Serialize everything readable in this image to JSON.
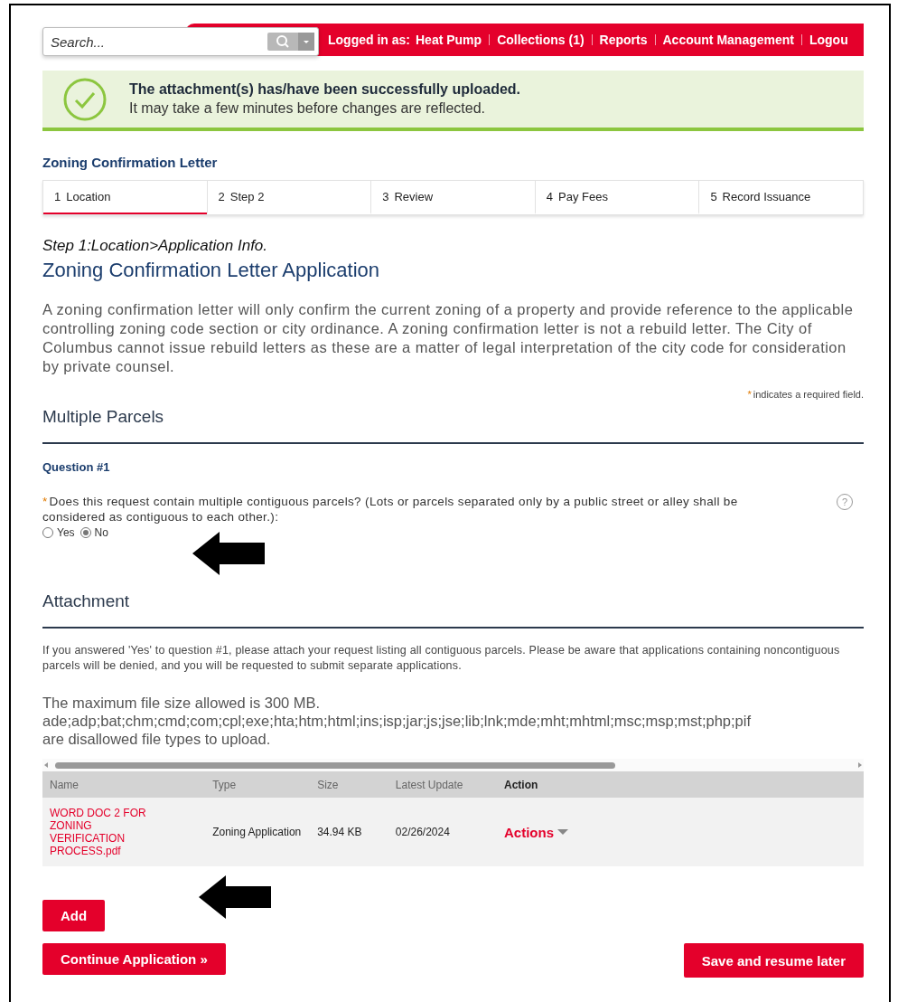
{
  "header": {
    "search": {
      "placeholder": "Search..."
    },
    "logged_in_label": "Logged in as:",
    "links": [
      "Heat Pump",
      "Collections (1)",
      "Reports",
      "Account Management",
      "Logou"
    ]
  },
  "notice": {
    "title": "The attachment(s) has/have been successfully uploaded.",
    "message": "It may take a few minutes before changes are reflected."
  },
  "record_type": "Zoning Confirmation Letter",
  "steps": [
    {
      "number": "1",
      "label": "Location",
      "selected": true
    },
    {
      "number": "2",
      "label": "Step 2",
      "selected": false
    },
    {
      "number": "3",
      "label": "Review",
      "selected": false
    },
    {
      "number": "4",
      "label": "Pay Fees",
      "selected": false
    },
    {
      "number": "5",
      "label": "Record Issuance",
      "selected": false
    }
  ],
  "breadcrumb": "Step 1:Location>Application Info.",
  "page_title": "Zoning Confirmation Letter Application",
  "intro": "A zoning confirmation letter will only confirm the current zoning of a property and provide reference to the applicable controlling zoning code section or city ordinance. A zoning confirmation letter is not a rebuild letter. The City of Columbus cannot issue rebuild letters as these are a matter of legal interpretation of the city code for consideration by private counsel.",
  "required_mark": "*",
  "required_note": "indicates a required field.",
  "parcels": {
    "heading": "Multiple Parcels",
    "question_title": "Question #1",
    "question": "Does this request contain multiple contiguous parcels? (Lots or parcels separated only by a public street or alley shall be considered as contiguous to each other.):",
    "help": "?",
    "options": [
      {
        "label": "Yes",
        "selected": false
      },
      {
        "label": "No",
        "selected": true
      }
    ]
  },
  "attachment": {
    "heading": "Attachment",
    "instructions": "If you answered 'Yes'  to question #1, please attach your request listing all contiguous parcels. Please be aware that applications containing noncontiguous parcels will be denied, and you will be requested to submit separate applications.",
    "max_size": "The maximum file size allowed is 300 MB.",
    "file_types": "ade;adp;bat;chm;cmd;com;cpl;exe;hta;htm;html;ins;isp;jar;js;jse;lib;lnk;mde;mht;mhtml;msc;msp;mst;php;pif",
    "disallowed_note": "are disallowed file types to upload.",
    "table": {
      "columns": [
        "Name",
        "Type",
        "Size",
        "Latest Update",
        "Action"
      ],
      "rows": [
        {
          "name": "WORD DOC 2 FOR ZONING VERIFICATION PROCESS.pdf",
          "type": "Zoning Application",
          "size": "34.94 KB",
          "latest_update": "02/26/2024",
          "action": "Actions"
        }
      ]
    },
    "add_button": "Add"
  },
  "buttons": {
    "continue": "Continue Application »",
    "save": "Save and resume later"
  }
}
